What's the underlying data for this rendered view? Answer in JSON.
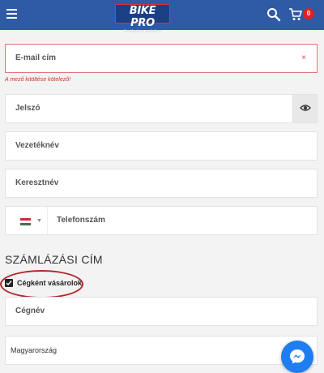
{
  "header": {
    "logo_main": "BIKE PRO",
    "logo_sub": "Kerékpáros webshop",
    "cart_count": "0",
    "brand_color": "#2f5aa5",
    "icons": [
      "menu-icon",
      "search-icon",
      "cart-icon"
    ]
  },
  "form": {
    "email_label": "E-mail cím",
    "email_error": "A mező kitöltése kötelező!",
    "password_label": "Jelszó",
    "lastname_label": "Vezetéknév",
    "firstname_label": "Keresztnév",
    "phone_label": "Telefonszám",
    "clear_icon": "×"
  },
  "billing": {
    "title": "SZÁMLÁZÁSI CÍM",
    "company_checkbox_label": "Cégként vásárolok",
    "company_checked": true,
    "company_name_label": "Cégnév",
    "country_value": "Magyarország"
  }
}
